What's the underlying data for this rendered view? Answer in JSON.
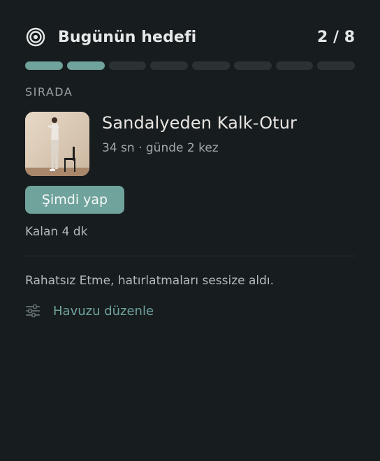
{
  "header": {
    "title": "Bugünün hedefi",
    "count": "2 / 8",
    "icon": "target-icon"
  },
  "progress": {
    "completed": 2,
    "total": 8,
    "colors": {
      "done": "#6fa39c",
      "pending": "#2a3234"
    }
  },
  "next": {
    "section_label": "SIRADA",
    "exercise_name": "Sandalyeden Kalk-Otur",
    "exercise_meta": "34 sn · günde 2 kez",
    "thumbnail": "exercise-thumbnail",
    "action_label": "Şimdi yap",
    "remaining": "Kalan 4 dk"
  },
  "footer": {
    "notice": "Rahatsız Etme, hatırlatmaları sessize aldı.",
    "edit_label": "Havuzu düzenle",
    "edit_icon": "sliders-icon"
  },
  "colors": {
    "background": "#171c1f",
    "accent": "#6fa39c",
    "text": "#e6e8e8",
    "muted": "#a3a9ab"
  }
}
